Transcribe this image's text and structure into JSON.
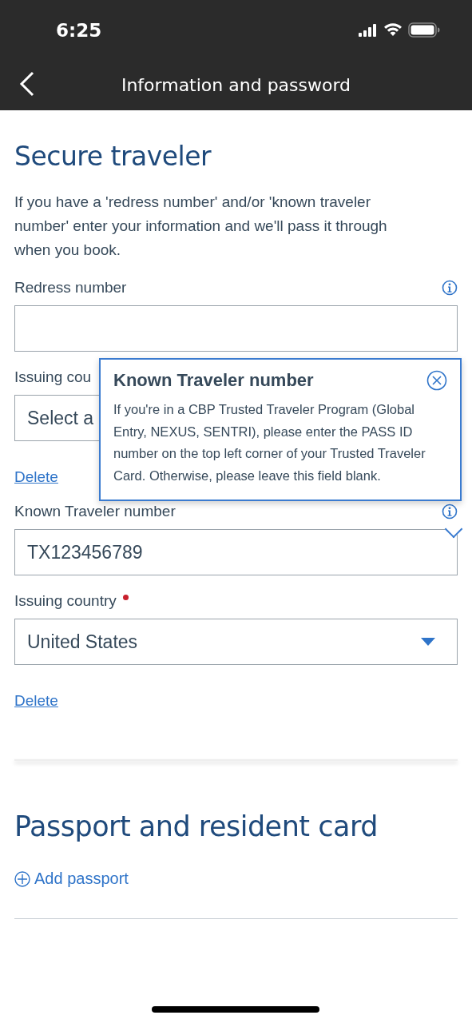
{
  "status_bar": {
    "time": "6:25"
  },
  "header": {
    "title": "Information and password"
  },
  "secure_traveler": {
    "heading": "Secure traveler",
    "description": "If you have a 'redress number' and/or 'known traveler number' enter your information and we'll pass it through when you book.",
    "groups": [
      {
        "label": "Redress number",
        "country_label": "Issuing cou",
        "country_required": false,
        "country_value": "Select a",
        "delete_link": "Delete"
      },
      {
        "label": "Known Traveler number",
        "value": "TX123456789",
        "country_label": "Issuing country",
        "country_required": true,
        "country_value": "United States",
        "caret": true,
        "delete_link": "Delete"
      }
    ]
  },
  "popover": {
    "title": "Known Traveler number",
    "body": "If you're in a CBP Trusted Traveler Program (Global Entry, NEXUS, SENTRI), please enter the PASS ID number on the top left corner of your Trusted Traveler Card. Otherwise, please leave this field blank."
  },
  "passport": {
    "heading": "Passport and resident card",
    "add_link": "Add passport"
  }
}
